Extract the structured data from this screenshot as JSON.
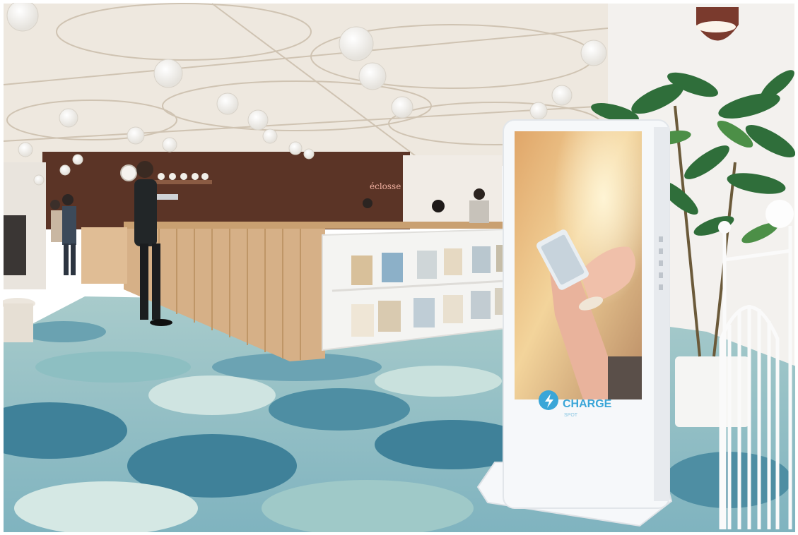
{
  "scene": {
    "description_free": true,
    "kiosk": {
      "brand_name": "CHARGE",
      "brand_sub": "SPOT",
      "accent_color": "#3aa6d8"
    },
    "shop_sign": {
      "text": "éclosse"
    },
    "colors": {
      "ceiling": "#efe9e0",
      "floor_light": "#b9d7d6",
      "floor_dark": "#4e8ea3",
      "counter_wood": "#d9b48a",
      "back_wall": "#5b3426",
      "kiosk_body": "#f6f8fa"
    }
  }
}
